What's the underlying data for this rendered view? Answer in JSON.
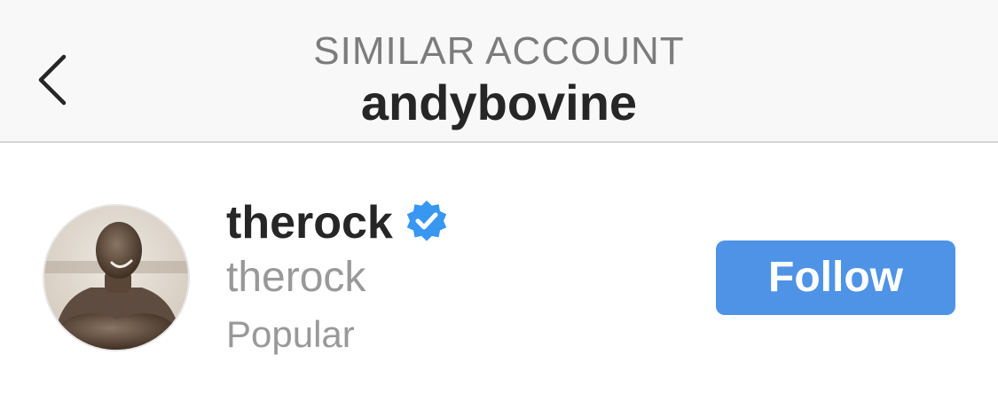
{
  "header": {
    "subtitle": "SIMILAR ACCOUNT",
    "title": "andybovine",
    "back_icon": "chevron-left-icon"
  },
  "account": {
    "username": "therock",
    "verified": true,
    "verified_icon": "verified-badge-icon",
    "full_name": "therock",
    "reason": "Popular",
    "follow_label": "Follow"
  },
  "colors": {
    "accent": "#4f93e6",
    "verified": "#3897f0",
    "header_bg": "#f8f8f8",
    "secondary_text": "#999999",
    "primary_text": "#262626"
  }
}
